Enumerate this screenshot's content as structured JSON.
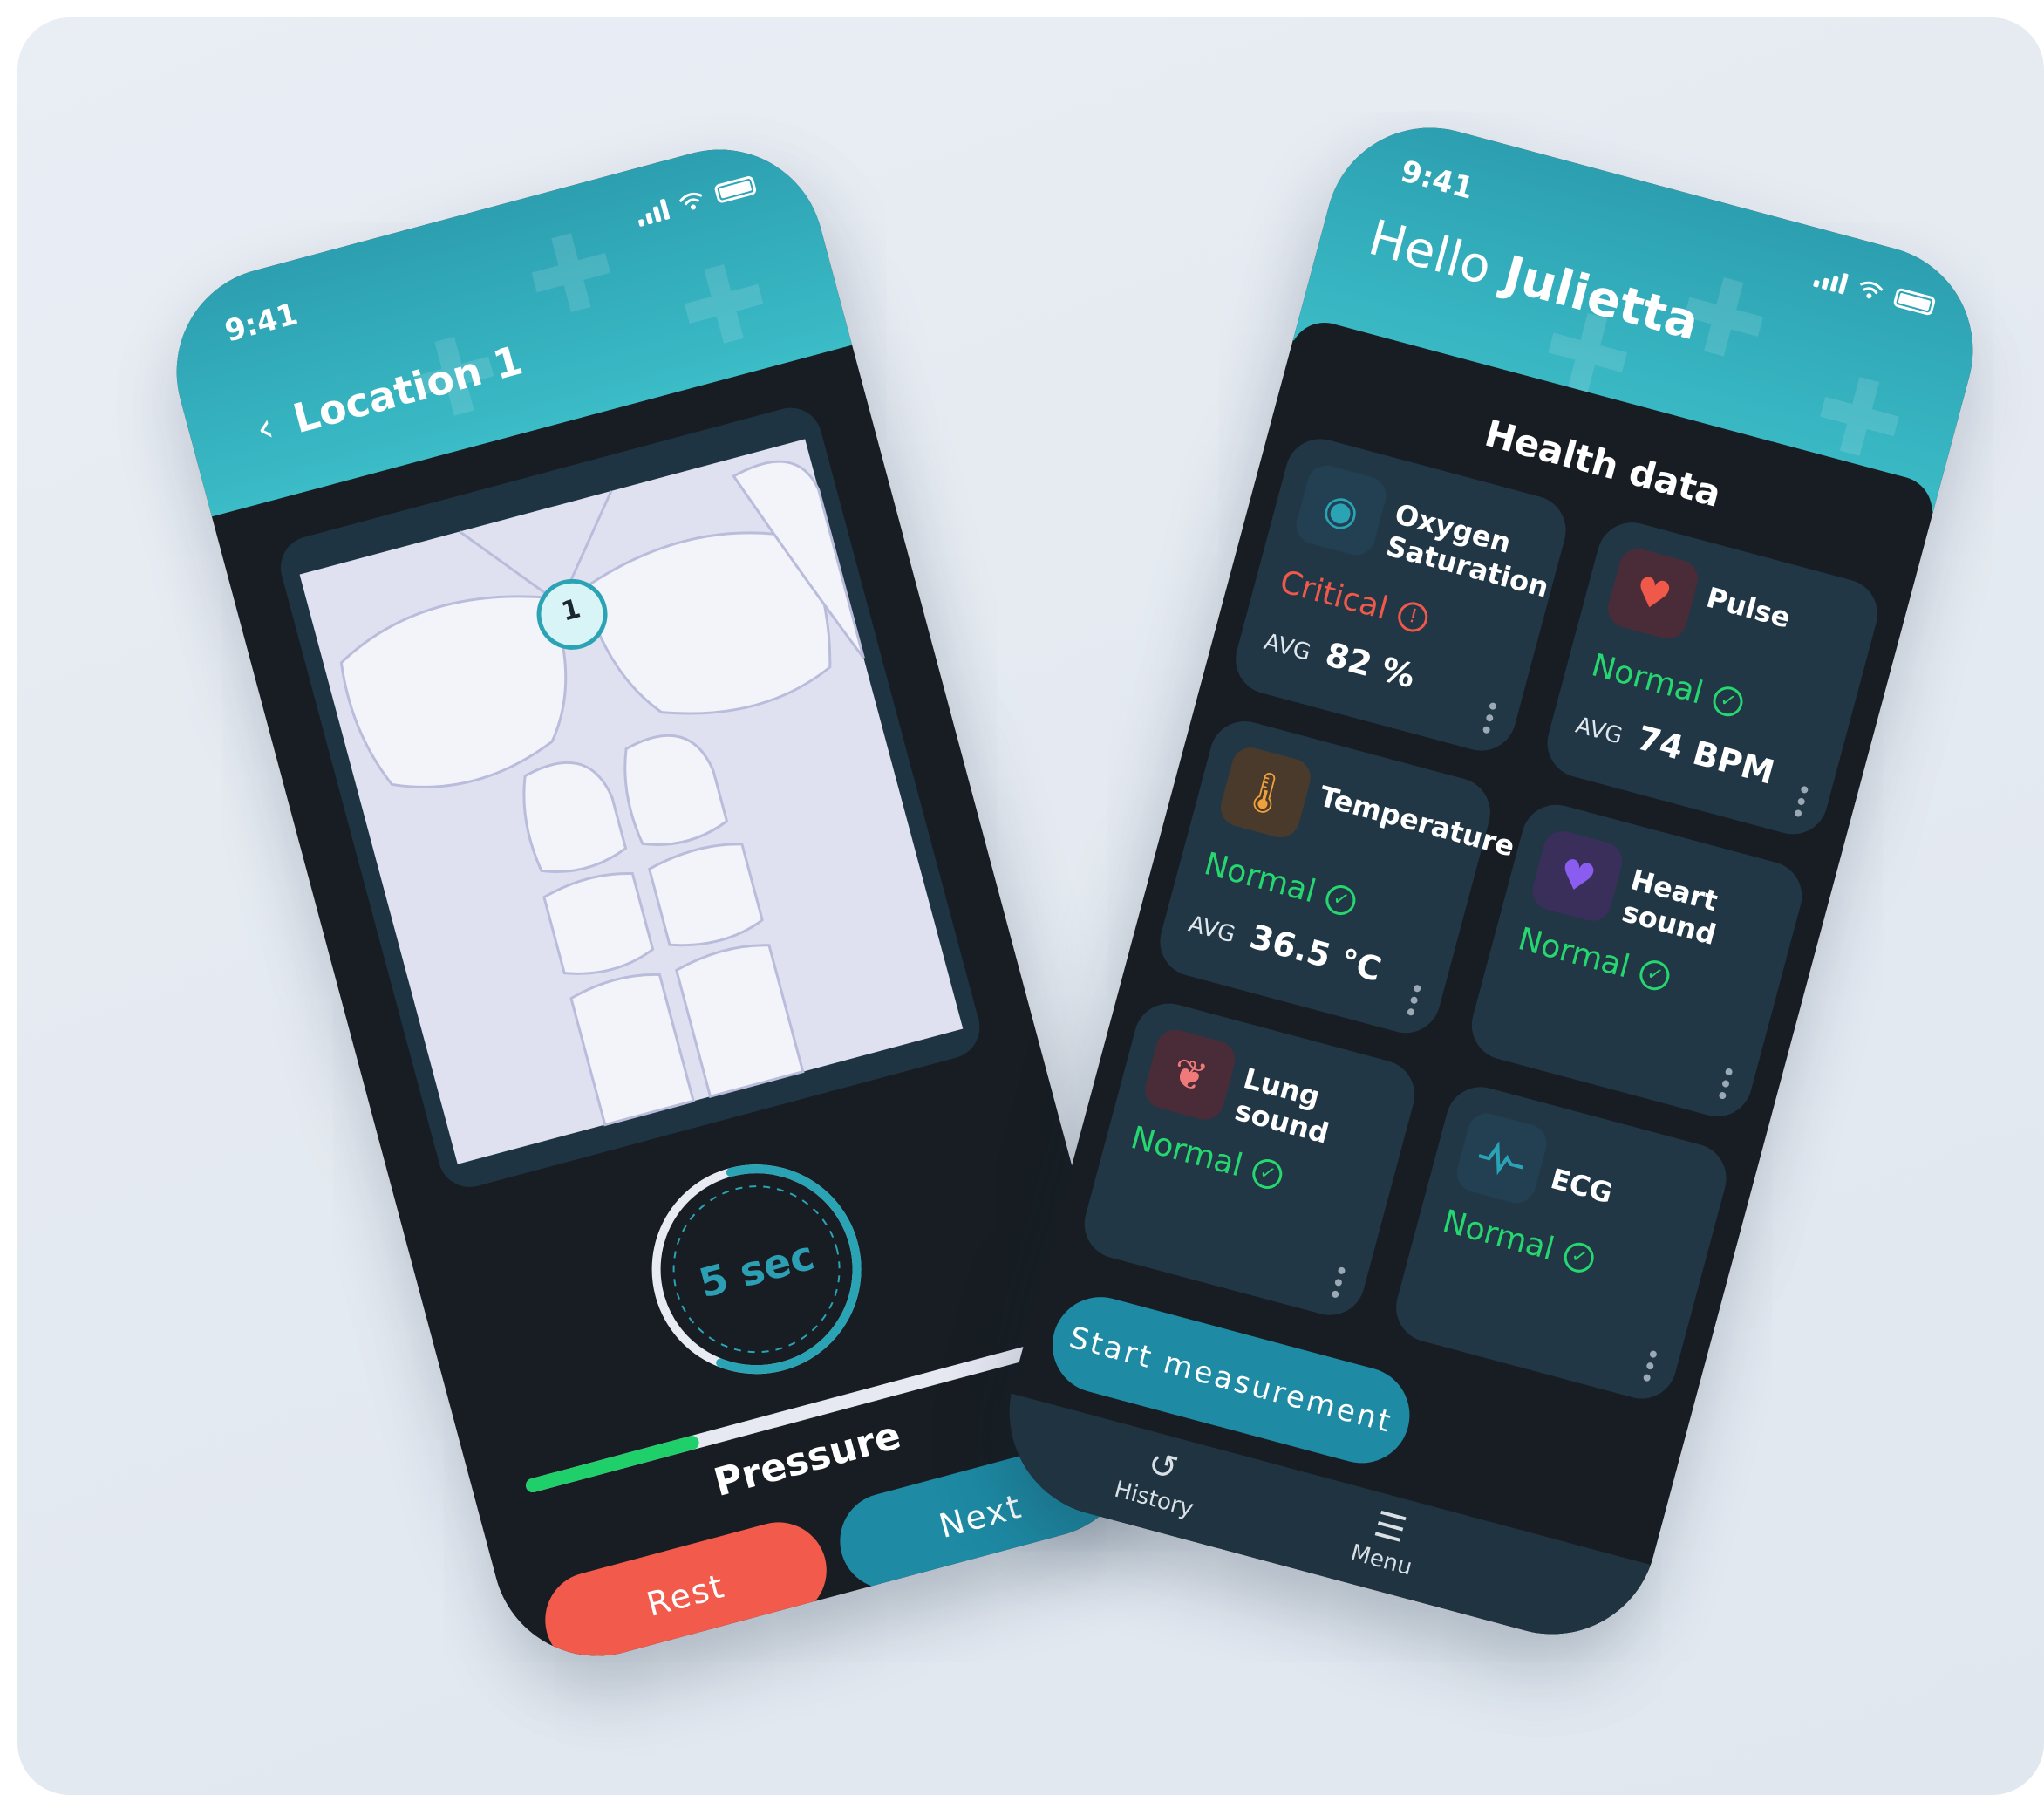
{
  "left_phone": {
    "status_time": "9:41",
    "nav_title": "Location 1",
    "marker_label": "1",
    "timer_label": "5 sec",
    "timer_progress": 0.6,
    "pressure_label": "Pressure",
    "pressure_progress": 0.32,
    "buttons": {
      "rest": "Rest",
      "next": "Next"
    },
    "colors": {
      "accent": "#2c9fb0",
      "rest": "#f25a4b",
      "next": "#1e8aa4",
      "pressure": "#1fcf6a"
    }
  },
  "right_phone": {
    "status_time": "9:41",
    "greeting": "Hello",
    "user_name": "Julietta",
    "section_title": "Health data",
    "cards": [
      {
        "title": "Oxygen Saturation",
        "status": "Critical",
        "avg_label": "AVG",
        "avg_value": "82 %",
        "icon": "oxygen-icon"
      },
      {
        "title": "Pulse",
        "status": "Normal",
        "avg_label": "AVG",
        "avg_value": "74 BPM",
        "icon": "heart-pulse-icon"
      },
      {
        "title": "Temperature",
        "status": "Normal",
        "avg_label": "AVG",
        "avg_value": "36.5 °C",
        "icon": "thermometer-icon"
      },
      {
        "title": "Heart sound",
        "status": "Normal",
        "icon": "heart-sound-icon"
      },
      {
        "title": "Lung sound",
        "status": "Normal",
        "icon": "lungs-icon"
      },
      {
        "title": "ECG",
        "status": "Normal",
        "icon": "ecg-icon"
      }
    ],
    "start_button": "Start measurement",
    "tabs": [
      {
        "label": "History",
        "icon": "history-icon"
      },
      {
        "label": "Menu",
        "icon": "menu-icon"
      }
    ],
    "colors": {
      "normal": "#26d66f",
      "critical": "#f0584a",
      "card": "#213746"
    }
  }
}
